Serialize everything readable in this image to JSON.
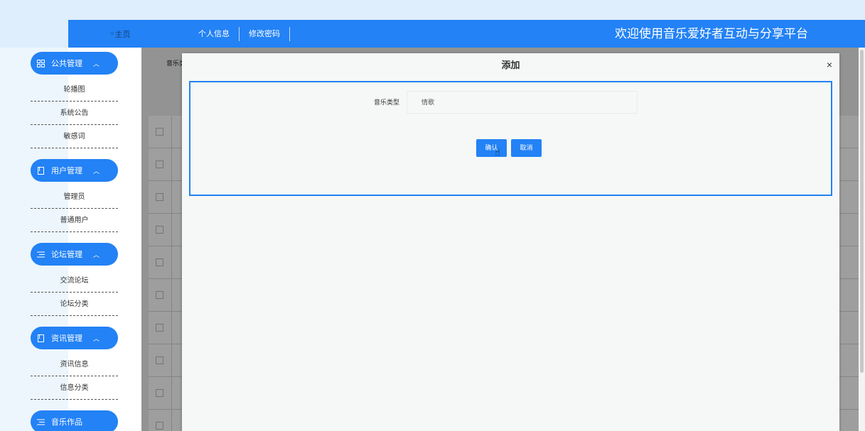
{
  "header": {
    "home_label": "主页",
    "nav": [
      "个人信息",
      "修改密码"
    ],
    "welcome": "欢迎使用音乐爱好者互动与分享平台"
  },
  "sidebar": {
    "groups": [
      {
        "label": "公共管理",
        "icon": "grid-icon",
        "items": [
          "轮播图",
          "系统公告",
          "敏感词"
        ]
      },
      {
        "label": "用户管理",
        "icon": "book-icon",
        "items": [
          "管理员",
          "普通用户"
        ]
      },
      {
        "label": "论坛管理",
        "icon": "list-icon",
        "items": [
          "交流论坛",
          "论坛分类"
        ]
      },
      {
        "label": "资讯管理",
        "icon": "book-icon",
        "items": [
          "资讯信息",
          "信息分类"
        ]
      },
      {
        "label": "音乐作品",
        "icon": "list-icon",
        "items": []
      }
    ]
  },
  "background": {
    "breadcrumb": "音乐类"
  },
  "modal": {
    "title": "添加",
    "close": "×",
    "field_label": "音乐类型",
    "field_value": "情歌",
    "confirm_label": "确认",
    "cancel_label": "取消"
  },
  "colors": {
    "primary": "#2382f5",
    "page_bg": "#dfeefc",
    "modal_bg": "#f5f8f7"
  }
}
